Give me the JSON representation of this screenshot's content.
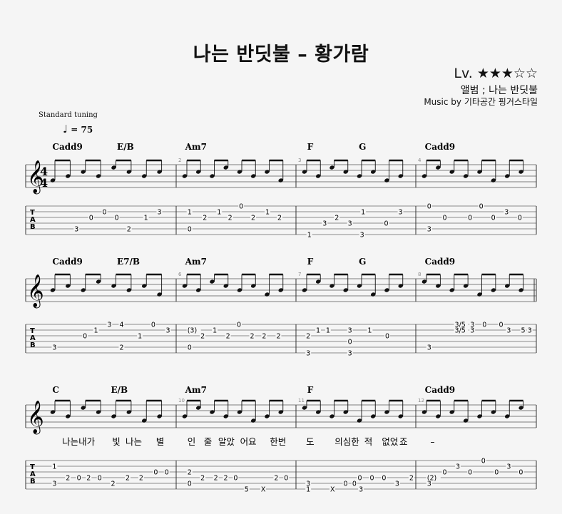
{
  "song": {
    "title": "나는 반딧불 – 황가람",
    "level": "Lv. ★★★☆☆",
    "album": "앨범 ; 나는 반딧불",
    "credit": "Music by 기타공간 핑거스타일",
    "tuning": "Standard tuning",
    "tempo": "= 75",
    "time_signature": "4/4"
  },
  "systems": [
    {
      "chords": [
        {
          "text": "Cadd9",
          "m": 0,
          "f": 0.02
        },
        {
          "text": "E/B",
          "m": 0,
          "f": 0.55
        },
        {
          "text": "Am7",
          "m": 1,
          "f": 0.03
        },
        {
          "text": "F",
          "m": 2,
          "f": 0.05
        },
        {
          "text": "G",
          "m": 2,
          "f": 0.52
        },
        {
          "text": "Cadd9",
          "m": 3,
          "f": 0.03
        }
      ],
      "tab": [
        {
          "t": "0",
          "m": 0,
          "f": 0.43,
          "s": 1
        },
        {
          "t": "0",
          "m": 0,
          "f": 0.32,
          "s": 2
        },
        {
          "t": "0",
          "m": 0,
          "f": 0.53,
          "s": 2
        },
        {
          "t": "1",
          "m": 0,
          "f": 0.77,
          "s": 2
        },
        {
          "t": "3",
          "m": 0,
          "f": 0.2,
          "s": 4
        },
        {
          "t": "2",
          "m": 0,
          "f": 0.63,
          "s": 4
        },
        {
          "t": "3",
          "m": 0,
          "f": 0.88,
          "s": 1
        },
        {
          "t": "1",
          "m": 1,
          "f": 0.05,
          "s": 1
        },
        {
          "t": "2",
          "m": 1,
          "f": 0.19,
          "s": 2
        },
        {
          "t": "2",
          "m": 1,
          "f": 0.42,
          "s": 2
        },
        {
          "t": "2",
          "m": 1,
          "f": 0.63,
          "s": 2
        },
        {
          "t": "2",
          "m": 1,
          "f": 0.87,
          "s": 2
        },
        {
          "t": "1",
          "m": 1,
          "f": 0.32,
          "s": 1
        },
        {
          "t": "0",
          "m": 1,
          "f": 0.52,
          "s": 0
        },
        {
          "t": "1",
          "m": 1,
          "f": 0.76,
          "s": 1
        },
        {
          "t": "0",
          "m": 1,
          "f": 0.05,
          "s": 4
        },
        {
          "t": "1",
          "m": 2,
          "f": 0.05,
          "s": 5
        },
        {
          "t": "3",
          "m": 2,
          "f": 0.19,
          "s": 3
        },
        {
          "t": "2",
          "m": 2,
          "f": 0.3,
          "s": 2
        },
        {
          "t": "3",
          "m": 2,
          "f": 0.42,
          "s": 3
        },
        {
          "t": "1",
          "m": 2,
          "f": 0.54,
          "s": 1
        },
        {
          "t": "3",
          "m": 2,
          "f": 0.53,
          "s": 5
        },
        {
          "t": "0",
          "m": 2,
          "f": 0.75,
          "s": 3
        },
        {
          "t": "3",
          "m": 2,
          "f": 0.88,
          "s": 1
        },
        {
          "t": "0",
          "m": 3,
          "f": 0.05,
          "s": 0
        },
        {
          "t": "3",
          "m": 3,
          "f": 0.05,
          "s": 4
        },
        {
          "t": "0",
          "m": 3,
          "f": 0.19,
          "s": 2
        },
        {
          "t": "0",
          "m": 3,
          "f": 0.42,
          "s": 2
        },
        {
          "t": "0",
          "m": 3,
          "f": 0.52,
          "s": 0
        },
        {
          "t": "0",
          "m": 3,
          "f": 0.63,
          "s": 2
        },
        {
          "t": "3",
          "m": 3,
          "f": 0.75,
          "s": 1
        },
        {
          "t": "0",
          "m": 3,
          "f": 0.87,
          "s": 2
        }
      ],
      "lyrics": []
    },
    {
      "chords": [
        {
          "text": "Cadd9",
          "m": 0,
          "f": 0.02
        },
        {
          "text": "E7/B",
          "m": 0,
          "f": 0.55
        },
        {
          "text": "Am7",
          "m": 1,
          "f": 0.03
        },
        {
          "text": "F",
          "m": 2,
          "f": 0.05
        },
        {
          "text": "G",
          "m": 2,
          "f": 0.52
        },
        {
          "text": "Cadd9",
          "m": 3,
          "f": 0.03
        }
      ],
      "tab": [
        {
          "t": "3",
          "m": 0,
          "f": 0.02,
          "s": 4
        },
        {
          "t": "0",
          "m": 0,
          "f": 0.27,
          "s": 2
        },
        {
          "t": "1",
          "m": 0,
          "f": 0.36,
          "s": 1
        },
        {
          "t": "3",
          "m": 0,
          "f": 0.47,
          "s": 0
        },
        {
          "t": "4",
          "m": 0,
          "f": 0.57,
          "s": 0
        },
        {
          "t": "2",
          "m": 0,
          "f": 0.57,
          "s": 4
        },
        {
          "t": "1",
          "m": 0,
          "f": 0.72,
          "s": 2
        },
        {
          "t": "0",
          "m": 0,
          "f": 0.83,
          "s": 0
        },
        {
          "t": "3",
          "m": 0,
          "f": 0.95,
          "s": 1
        },
        {
          "t": "(3)",
          "m": 1,
          "f": 0.05,
          "s": 1
        },
        {
          "t": "2",
          "m": 1,
          "f": 0.17,
          "s": 2
        },
        {
          "t": "1",
          "m": 1,
          "f": 0.28,
          "s": 1
        },
        {
          "t": "2",
          "m": 1,
          "f": 0.4,
          "s": 2
        },
        {
          "t": "0",
          "m": 1,
          "f": 0.5,
          "s": 0
        },
        {
          "t": "2",
          "m": 1,
          "f": 0.62,
          "s": 2
        },
        {
          "t": "2",
          "m": 1,
          "f": 0.73,
          "s": 2
        },
        {
          "t": "2",
          "m": 1,
          "f": 0.86,
          "s": 2
        },
        {
          "t": "0",
          "m": 1,
          "f": 0.05,
          "s": 4
        },
        {
          "t": "2",
          "m": 2,
          "f": 0.04,
          "s": 2
        },
        {
          "t": "3",
          "m": 2,
          "f": 0.04,
          "s": 5
        },
        {
          "t": "1",
          "m": 2,
          "f": 0.13,
          "s": 1
        },
        {
          "t": "1",
          "m": 2,
          "f": 0.22,
          "s": 1
        },
        {
          "t": "3",
          "m": 2,
          "f": 0.42,
          "s": 1
        },
        {
          "t": "0",
          "m": 2,
          "f": 0.42,
          "s": 3
        },
        {
          "t": "3",
          "m": 2,
          "f": 0.42,
          "s": 5
        },
        {
          "t": "1",
          "m": 2,
          "f": 0.6,
          "s": 1
        },
        {
          "t": "0",
          "m": 2,
          "f": 0.76,
          "s": 2
        },
        {
          "t": "3",
          "m": 3,
          "f": 0.05,
          "s": 4
        },
        {
          "t": "3/5",
          "m": 3,
          "f": 0.3,
          "s": 0
        },
        {
          "t": "3/5",
          "m": 3,
          "f": 0.3,
          "s": 1
        },
        {
          "t": "3",
          "m": 3,
          "f": 0.44,
          "s": 0
        },
        {
          "t": "3",
          "m": 3,
          "f": 0.44,
          "s": 1
        },
        {
          "t": "0",
          "m": 3,
          "f": 0.55,
          "s": 0
        },
        {
          "t": "0",
          "m": 3,
          "f": 0.7,
          "s": 0
        },
        {
          "t": "3",
          "m": 3,
          "f": 0.77,
          "s": 1
        },
        {
          "t": "5",
          "m": 3,
          "f": 0.9,
          "s": 1
        },
        {
          "t": "3",
          "m": 3,
          "f": 0.96,
          "s": 1
        }
      ],
      "lyrics": []
    },
    {
      "chords": [
        {
          "text": "C",
          "m": 0,
          "f": 0.02
        },
        {
          "text": "E/B",
          "m": 0,
          "f": 0.5
        },
        {
          "text": "Am7",
          "m": 1,
          "f": 0.03
        },
        {
          "text": "F",
          "m": 2,
          "f": 0.05
        },
        {
          "text": "Cadd9",
          "m": 3,
          "f": 0.03
        }
      ],
      "tab": [
        {
          "t": "1",
          "m": 0,
          "f": 0.02,
          "s": 1
        },
        {
          "t": "3",
          "m": 0,
          "f": 0.02,
          "s": 4
        },
        {
          "t": "2",
          "m": 0,
          "f": 0.13,
          "s": 3
        },
        {
          "t": "0",
          "m": 0,
          "f": 0.22,
          "s": 3
        },
        {
          "t": "2",
          "m": 0,
          "f": 0.3,
          "s": 3
        },
        {
          "t": "0",
          "m": 0,
          "f": 0.39,
          "s": 3
        },
        {
          "t": "2",
          "m": 0,
          "f": 0.5,
          "s": 4
        },
        {
          "t": "2",
          "m": 0,
          "f": 0.62,
          "s": 3
        },
        {
          "t": "2",
          "m": 0,
          "f": 0.73,
          "s": 3
        },
        {
          "t": "0",
          "m": 0,
          "f": 0.85,
          "s": 2
        },
        {
          "t": "0",
          "m": 0,
          "f": 0.94,
          "s": 2
        },
        {
          "t": "2",
          "m": 1,
          "f": 0.05,
          "s": 2
        },
        {
          "t": "0",
          "m": 1,
          "f": 0.05,
          "s": 4
        },
        {
          "t": "2",
          "m": 1,
          "f": 0.17,
          "s": 3
        },
        {
          "t": "2",
          "m": 1,
          "f": 0.29,
          "s": 3
        },
        {
          "t": "2",
          "m": 1,
          "f": 0.38,
          "s": 3
        },
        {
          "t": "0",
          "m": 1,
          "f": 0.47,
          "s": 3
        },
        {
          "t": "5",
          "m": 1,
          "f": 0.57,
          "s": 5
        },
        {
          "t": "X",
          "m": 1,
          "f": 0.72,
          "s": 5
        },
        {
          "t": "2",
          "m": 1,
          "f": 0.84,
          "s": 3
        },
        {
          "t": "0",
          "m": 1,
          "f": 0.93,
          "s": 3
        },
        {
          "t": "3",
          "m": 2,
          "f": 0.04,
          "s": 4
        },
        {
          "t": "1",
          "m": 2,
          "f": 0.04,
          "s": 5
        },
        {
          "t": "X",
          "m": 2,
          "f": 0.26,
          "s": 5
        },
        {
          "t": "0",
          "m": 2,
          "f": 0.38,
          "s": 4
        },
        {
          "t": "0",
          "m": 2,
          "f": 0.46,
          "s": 4
        },
        {
          "t": "3",
          "m": 2,
          "f": 0.52,
          "s": 5
        },
        {
          "t": "0",
          "m": 2,
          "f": 0.51,
          "s": 3
        },
        {
          "t": "0",
          "m": 2,
          "f": 0.62,
          "s": 3
        },
        {
          "t": "0",
          "m": 2,
          "f": 0.73,
          "s": 3
        },
        {
          "t": "3",
          "m": 2,
          "f": 0.85,
          "s": 4
        },
        {
          "t": "2",
          "m": 2,
          "f": 0.98,
          "s": 3
        },
        {
          "t": "(2)",
          "m": 3,
          "f": 0.05,
          "s": 3
        },
        {
          "t": "3",
          "m": 3,
          "f": 0.05,
          "s": 4
        },
        {
          "t": "0",
          "m": 3,
          "f": 0.19,
          "s": 2
        },
        {
          "t": "3",
          "m": 3,
          "f": 0.31,
          "s": 1
        },
        {
          "t": "0",
          "m": 3,
          "f": 0.42,
          "s": 2
        },
        {
          "t": "0",
          "m": 3,
          "f": 0.54,
          "s": 0
        },
        {
          "t": "0",
          "m": 3,
          "f": 0.66,
          "s": 2
        },
        {
          "t": "3",
          "m": 3,
          "f": 0.77,
          "s": 1
        },
        {
          "t": "0",
          "m": 3,
          "f": 0.88,
          "s": 2
        }
      ],
      "lyrics": [
        {
          "text": "나는내가",
          "m": 0,
          "f": 0.1
        },
        {
          "text": "빛",
          "m": 0,
          "f": 0.51
        },
        {
          "text": "나는",
          "m": 0,
          "f": 0.62
        },
        {
          "text": "별",
          "m": 0,
          "f": 0.87
        },
        {
          "text": "인",
          "m": 1,
          "f": 0.05
        },
        {
          "text": "줄",
          "m": 1,
          "f": 0.2
        },
        {
          "text": "알았",
          "m": 1,
          "f": 0.33
        },
        {
          "text": "어요",
          "m": 1,
          "f": 0.53
        },
        {
          "text": "한번",
          "m": 1,
          "f": 0.8
        },
        {
          "text": "도",
          "m": 2,
          "f": 0.04
        },
        {
          "text": "의심한",
          "m": 2,
          "f": 0.3
        },
        {
          "text": "적",
          "m": 2,
          "f": 0.57
        },
        {
          "text": "없었",
          "m": 2,
          "f": 0.73
        },
        {
          "text": "죠",
          "m": 2,
          "f": 0.89
        },
        {
          "text": "–",
          "m": 3,
          "f": 0.08
        }
      ]
    }
  ]
}
